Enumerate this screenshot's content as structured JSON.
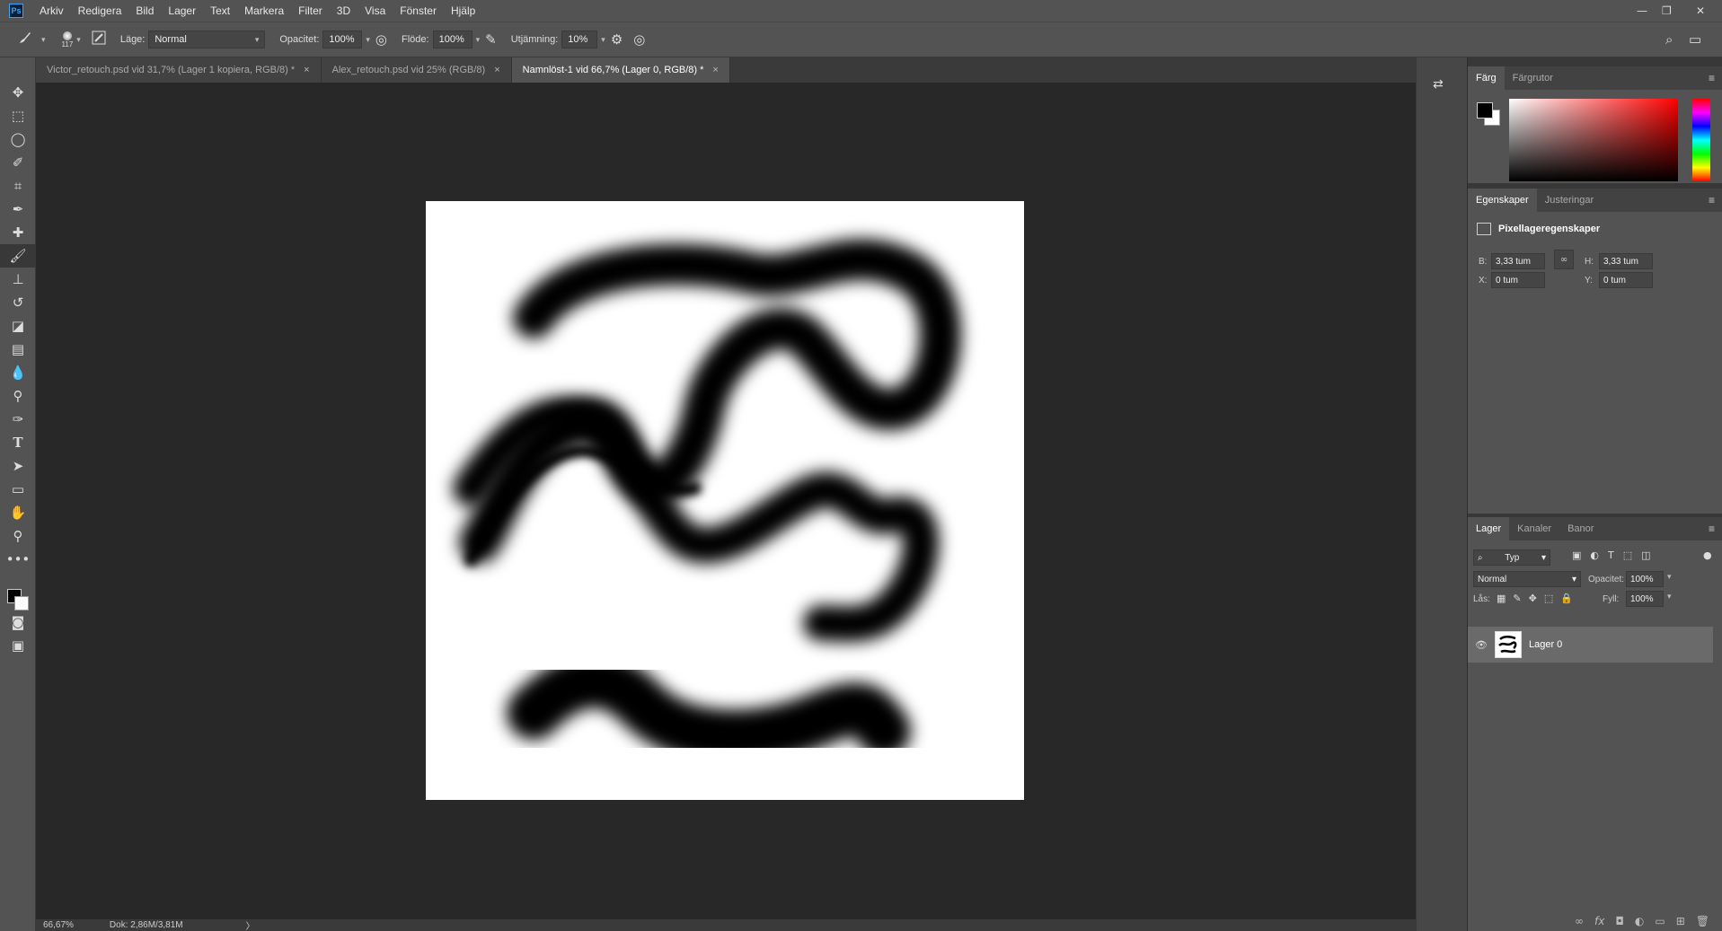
{
  "app": {
    "logo": "Ps"
  },
  "menu": [
    "Arkiv",
    "Redigera",
    "Bild",
    "Lager",
    "Text",
    "Markera",
    "Filter",
    "3D",
    "Visa",
    "Fönster",
    "Hjälp"
  ],
  "window_controls": {
    "minimize": "—",
    "restore": "❐",
    "close": "✕"
  },
  "options_bar": {
    "brush_size": "117",
    "mode_label": "Läge:",
    "mode_value": "Normal",
    "opacity_label": "Opacitet:",
    "opacity_value": "100%",
    "flow_label": "Flöde:",
    "flow_value": "100%",
    "smoothing_label": "Utjämning:",
    "smoothing_value": "10%"
  },
  "tabs": [
    {
      "label": "Victor_retouch.psd vid 31,7% (Lager 1 kopiera, RGB/8) *",
      "close": "×"
    },
    {
      "label": "Alex_retouch.psd vid 25% (RGB/8)",
      "close": "×"
    },
    {
      "label": "Namnlöst-1 vid 66,7% (Lager 0, RGB/8) *",
      "close": "×",
      "active": true
    }
  ],
  "status": {
    "zoom": "66,67%",
    "doc": "Dok: 2,86M/3,81M",
    "arrow": "〉"
  },
  "color_panel": {
    "tabs": [
      "Färg",
      "Färgrutor"
    ],
    "fg": "#000000",
    "bg": "#ffffff",
    "hue": "#ff0000"
  },
  "properties_panel": {
    "tabs": [
      "Egenskaper",
      "Justeringar"
    ],
    "title": "Pixellageregenskaper",
    "w_label": "B:",
    "w_value": "3,33 tum",
    "h_label": "H:",
    "h_value": "3,33 tum",
    "x_label": "X:",
    "x_value": "0 tum",
    "y_label": "Y:",
    "y_value": "0 tum"
  },
  "layers_panel": {
    "tabs": [
      "Lager",
      "Kanaler",
      "Banor"
    ],
    "filter_value": "Typ",
    "blend_value": "Normal",
    "opacity_label": "Opacitet:",
    "opacity_value": "100%",
    "lock_label": "Lås:",
    "fill_label": "Fyll:",
    "fill_value": "100%",
    "layers": [
      {
        "name": "Lager 0"
      }
    ]
  },
  "colors": {
    "ui_dark": "#535353",
    "canvas_bg": "#282828",
    "accent_logo": "#31a8ff"
  }
}
